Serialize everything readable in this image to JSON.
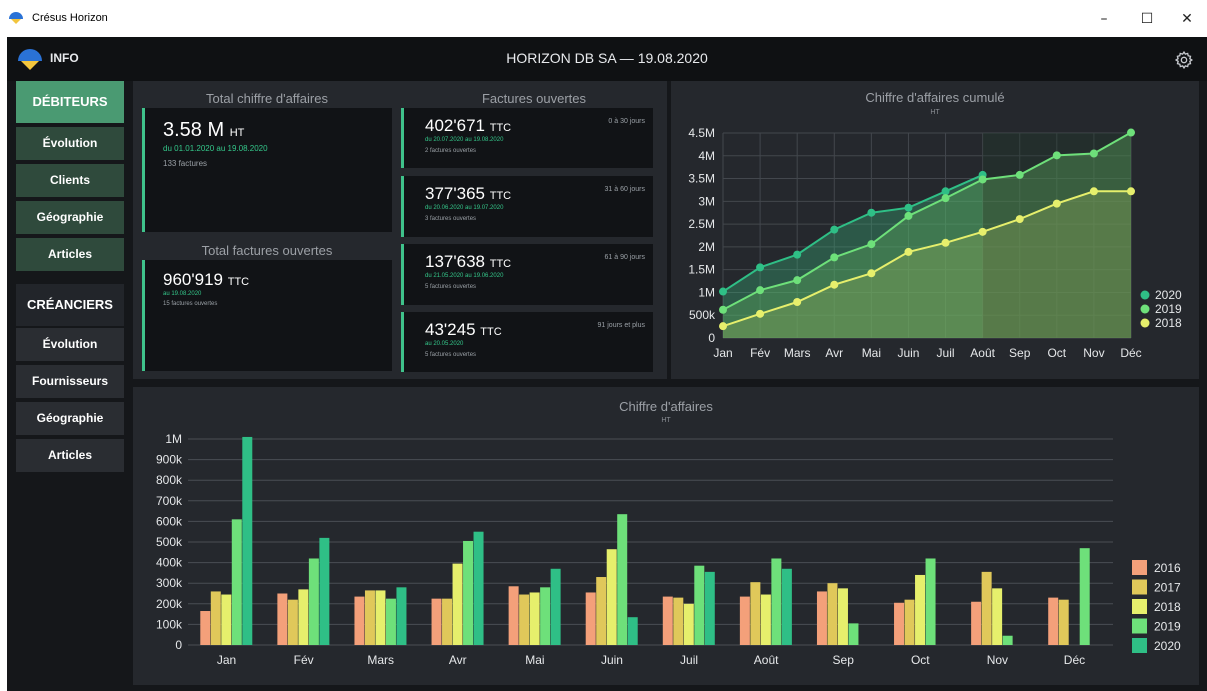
{
  "window": {
    "title": "Crésus Horizon",
    "controls": {
      "minimize": "–",
      "maximize": "☐",
      "close": "✕"
    }
  },
  "header": {
    "info_label": "INFO",
    "title": "HORIZON DB SA — 19.08.2020",
    "settings_icon": "gear-icon"
  },
  "sidebar": {
    "debiteurs": "DÉBITEURS",
    "deb_items": [
      "Évolution",
      "Clients",
      "Géographie",
      "Articles"
    ],
    "creanciers": "CRÉANCIERS",
    "cred_items": [
      "Évolution",
      "Fournisseurs",
      "Géographie",
      "Articles"
    ]
  },
  "total_ca": {
    "heading": "Total chiffre d'affaires",
    "value": "3.58 M",
    "unit": "HT",
    "period": "du 01.01.2020 au 19.08.2020",
    "count": "133 factures"
  },
  "total_open": {
    "heading": "Total factures ouvertes",
    "value": "960'919",
    "unit": "TTC",
    "date": "au 19.08.2020",
    "count": "15 factures ouvertes"
  },
  "open_invoices": {
    "heading": "Factures ouvertes",
    "cards": [
      {
        "value": "402'671",
        "unit": "TTC",
        "range": "0 à 30 jours",
        "period": "du 20.07.2020 au 19.08.2020",
        "count": "2 factures ouvertes"
      },
      {
        "value": "377'365",
        "unit": "TTC",
        "range": "31 à 60 jours",
        "period": "du 20.06.2020 au 19.07.2020",
        "count": "3 factures ouvertes"
      },
      {
        "value": "137'638",
        "unit": "TTC",
        "range": "61 à 90 jours",
        "period": "du 21.05.2020 au 19.06.2020",
        "count": "5 factures ouvertes"
      },
      {
        "value": "43'245",
        "unit": "TTC",
        "range": "91 jours et plus",
        "period": "au 20.05.2020",
        "count": "5 factures ouvertes"
      }
    ]
  },
  "colors": {
    "accent": "#3fc28b",
    "s2016": "#f4a07a",
    "s2017": "#e0c85a",
    "s2018": "#e6ef6c",
    "s2019": "#6ee07a",
    "s2020": "#2fbf86"
  },
  "chart_data": [
    {
      "type": "line",
      "title": "Chiffre d'affaires cumulé",
      "subtitle": "HT",
      "categories": [
        "Jan",
        "Fév",
        "Mars",
        "Avr",
        "Mai",
        "Juin",
        "Juil",
        "Août",
        "Sep",
        "Oct",
        "Nov",
        "Déc"
      ],
      "y_ticks": [
        "0",
        "500k",
        "1M",
        "1.5M",
        "2M",
        "2.5M",
        "3M",
        "3.5M",
        "4M",
        "4.5M"
      ],
      "ylim": [
        0,
        4500000
      ],
      "legend_position": "bottom-right",
      "series": [
        {
          "name": "2020",
          "color": "#2fbf86",
          "values": [
            1020000,
            1550000,
            1830000,
            2380000,
            2750000,
            2860000,
            3220000,
            3580000
          ]
        },
        {
          "name": "2019",
          "color": "#6ee07a",
          "values": [
            620000,
            1050000,
            1270000,
            1770000,
            2060000,
            2680000,
            3070000,
            3480000,
            3580000,
            4010000,
            4050000,
            4510000
          ]
        },
        {
          "name": "2018",
          "color": "#e6ef6c",
          "values": [
            260000,
            530000,
            790000,
            1170000,
            1420000,
            1890000,
            2090000,
            2330000,
            2610000,
            2950000,
            3220000,
            3220000
          ]
        }
      ]
    },
    {
      "type": "bar",
      "title": "Chiffre d'affaires",
      "subtitle": "HT",
      "categories": [
        "Jan",
        "Fév",
        "Mars",
        "Avr",
        "Mai",
        "Juin",
        "Juil",
        "Août",
        "Sep",
        "Oct",
        "Nov",
        "Déc"
      ],
      "y_ticks": [
        "0",
        "100k",
        "200k",
        "300k",
        "400k",
        "500k",
        "600k",
        "700k",
        "800k",
        "900k",
        "1M"
      ],
      "ylim": [
        0,
        1000000
      ],
      "legend_position": "right",
      "series": [
        {
          "name": "2016",
          "color": "#f4a07a",
          "values": [
            165000,
            250000,
            235000,
            225000,
            285000,
            255000,
            235000,
            235000,
            260000,
            205000,
            210000,
            230000
          ]
        },
        {
          "name": "2017",
          "color": "#e0c85a",
          "values": [
            260000,
            220000,
            265000,
            225000,
            245000,
            330000,
            230000,
            305000,
            300000,
            220000,
            355000,
            220000
          ]
        },
        {
          "name": "2018",
          "color": "#e6ef6c",
          "values": [
            245000,
            270000,
            265000,
            395000,
            255000,
            465000,
            200000,
            245000,
            275000,
            340000,
            275000,
            0
          ]
        },
        {
          "name": "2019",
          "color": "#6ee07a",
          "values": [
            610000,
            420000,
            225000,
            505000,
            280000,
            635000,
            385000,
            420000,
            105000,
            420000,
            45000,
            470000
          ]
        },
        {
          "name": "2020",
          "color": "#2fbf86",
          "values": [
            1010000,
            520000,
            280000,
            550000,
            370000,
            135000,
            355000,
            370000,
            0,
            0,
            0,
            0
          ]
        }
      ]
    }
  ]
}
